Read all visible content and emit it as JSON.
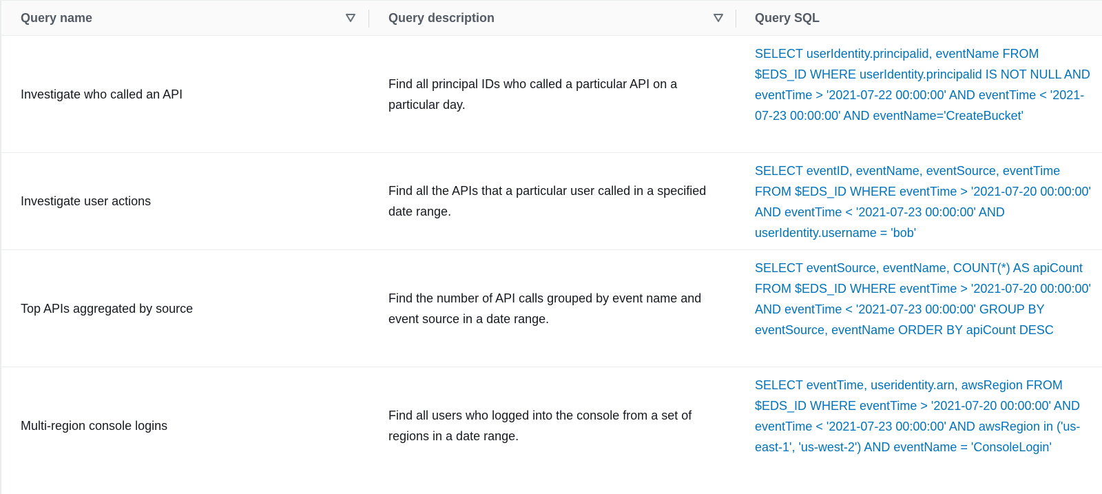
{
  "table": {
    "columns": [
      {
        "label": "Query name",
        "sortable": true
      },
      {
        "label": "Query description",
        "sortable": true
      },
      {
        "label": "Query SQL",
        "sortable": false
      }
    ],
    "rows": [
      {
        "name": "Investigate who called an API",
        "description": "Find all principal IDs who called a particular API on a particular day.",
        "sql": "SELECT userIdentity.principalid, eventName FROM $EDS_ID WHERE userIdentity.principalid IS NOT NULL AND eventTime > '2021-07-22 00:00:00' AND eventTime < '2021-07-23 00:00:00' AND eventName='CreateBucket'"
      },
      {
        "name": "Investigate user actions",
        "description": "Find all the APIs that a particular user called in a specified date range.",
        "sql": "SELECT eventID, eventName, eventSource, eventTime FROM $EDS_ID WHERE eventTime > '2021-07-20 00:00:00' AND eventTime < '2021-07-23 00:00:00' AND userIdentity.username = 'bob'"
      },
      {
        "name": "Top APIs aggregated by source",
        "description": "Find the number of API calls grouped by event name and event source in a date range.",
        "sql": "SELECT eventSource, eventName, COUNT(*) AS apiCount FROM $EDS_ID WHERE eventTime > '2021-07-20 00:00:00' AND eventTime < '2021-07-23 00:00:00' GROUP BY eventSource, eventName ORDER BY apiCount DESC"
      },
      {
        "name": "Multi-region console logins",
        "description": "Find all users who logged into the console from a set of regions in a date range.",
        "sql": "SELECT eventTime, useridentity.arn, awsRegion FROM $EDS_ID WHERE eventTime > '2021-07-20 00:00:00' AND eventTime < '2021-07-23 00:00:00' AND awsRegion in ('us-east-1', 'us-west-2') AND eventName = 'ConsoleLogin'"
      }
    ]
  },
  "colors": {
    "header_bg": "#fafafa",
    "header_text": "#545b64",
    "link": "#0073bb",
    "border": "#eaeded"
  },
  "icons": {
    "sort": "caret-down-icon"
  }
}
